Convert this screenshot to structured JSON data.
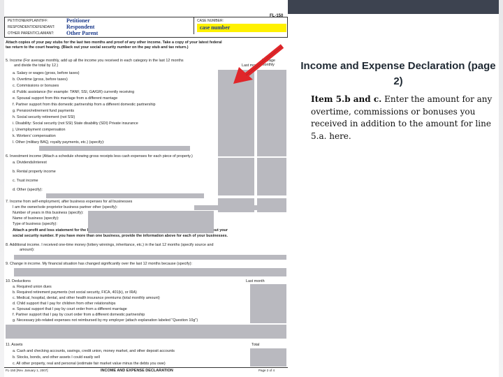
{
  "form": {
    "form_number": "FL-150",
    "header_labels": [
      "PETITIONER/PLAINTIFF:",
      "RESPONDENT/DEFENDANT:",
      "OTHER PARENT/CLAIMANT:"
    ],
    "header_values": [
      "Petitioner",
      "Respondent",
      "Other Parent"
    ],
    "case_number_label": "CASE NUMBER:",
    "case_number_value": "case number",
    "intro_line1": "Attach copies of your pay stubs for the last two months and proof of any other income. Take a copy of your latest federal",
    "intro_line2": "tax return to the court hearing. (Black out your social security number on the pay stub and tax return.)",
    "item5_title": "5.  Income (For average monthly, add up all the income you received in each category in the last 12 months",
    "item5_sub": "and divide the total by 12.)",
    "col_last_month": "Last month",
    "col_average": "Average monthly",
    "item5_rows": [
      "a. Salary or wages (gross, before taxes)",
      "b. Overtime (gross, before taxes)",
      "c. Commissions or bonuses",
      "d. Public assistance (for example: TANF, SSI, GA/GR)     currently receiving",
      "e. Spousal support       from this marriage       from a different marriage",
      "f. Partner support       from this domestic partnership       from a different domestic partnership",
      "g. Pension/retirement fund payments",
      "h. Social security retirement (not SSI)",
      "i. Disability:      Social security (not SSI)      State disability (SDI)      Private insurance",
      "j. Unemployment compensation",
      "k. Workers' compensation",
      "l. Other (military BAQ, royalty payments, etc.) (specify):"
    ],
    "item6_title": "6.  Investment income (Attach a schedule showing gross receipts less cash expenses for each piece of property.)",
    "item6_rows": [
      "a. Dividends/interest",
      "b. Rental property income",
      "c. Trust income",
      "d. Other (specify):"
    ],
    "item7_title": "7.  Income from self-employment, after business expenses for all businesses",
    "item7_rows": [
      "I am the       owner/sole proprietor       business partner       other (specify):",
      "Number of years in this business (specify):",
      "Name of business (specify):",
      "Type of business (specify):"
    ],
    "item7_note1": "Attach a profit and loss statement for the last two years or a Schedule C from your last federal tax return. Black out your",
    "item7_note2": "social security number. If you have more than one business, provide the information above for each of your businesses.",
    "item8_text": "8.      Additional income. I received one-time money (lottery winnings, inheritance, etc.) in the last 12 months (specify source and",
    "item8_sub": "amount):",
    "item9_text": "9.      Change in income. My financial situation has changed significantly over the last 12 months because (specify):",
    "item10_title": "10. Deductions",
    "item10_col": "Last month",
    "item10_rows": [
      "a. Required union dues",
      "b. Required retirement payments (not social security, FICA, 401(k), or IRA)",
      "c. Medical, hospital, dental, and other health insurance premiums (total monthly amount)",
      "d. Child support that I pay for children from other relationships",
      "e. Spousal support that I pay by court order from a different marriage",
      "f. Partner support that I pay by court order from a different domestic partnership",
      "g. Necessary job-related expenses not reimbursed by my employer (attach explanation labeled \"Question 10g\")"
    ],
    "item11_title": "11. Assets",
    "item11_col": "Total",
    "item11_rows": [
      "a. Cash and checking accounts, savings, credit union, money market, and other deposit accounts",
      "b. Stocks, bonds, and other assets I could easily sell",
      "c. All other property,       real and       personal (estimate fair market value minus the debts you owe)"
    ],
    "footer_left": "FL-150 [Rev. January 1, 2007]",
    "footer_center": "INCOME AND EXPENSE DECLARATION",
    "footer_right": "Page 2 of 4"
  },
  "slide": {
    "title": "Income and Expense Declaration (page 2)",
    "item_label": "Item 5.b and c.",
    "body_text": "Enter the amount for any overtime, commissions or bonuses you received in addition to the amount for line 5.a. here."
  },
  "colors": {
    "topbar": "#3d4350",
    "arrow": "#e0262a",
    "highlight": "#fff100",
    "field_gray": "#b9b9bf",
    "filled_text": "#1b3a8c"
  }
}
